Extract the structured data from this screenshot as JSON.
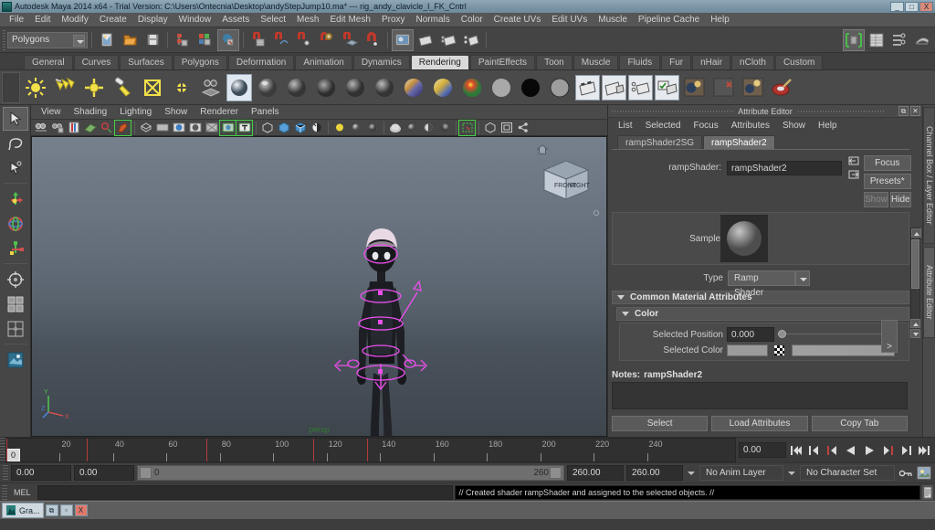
{
  "window": {
    "title": "Autodesk Maya 2014 x64 - Trial Version: C:\\Users\\Ontecnia\\Desktop\\andyStepJump10.ma*   ---   rig_andy_clavicle_l_FK_Cntrl",
    "minimize": "_",
    "maximize": "□",
    "close": "X"
  },
  "menubar": {
    "items": [
      "File",
      "Edit",
      "Modify",
      "Create",
      "Display",
      "Window",
      "Assets",
      "Select",
      "Mesh",
      "Edit Mesh",
      "Proxy",
      "Normals",
      "Color",
      "Create UVs",
      "Edit UVs",
      "Muscle",
      "Pipeline Cache",
      "Help"
    ]
  },
  "statusline": {
    "mode_selector": "Polygons",
    "icons": [
      "new-scene-icon",
      "open-scene-icon",
      "save-scene-icon",
      "select-hierarchy-icon",
      "select-object-icon",
      "select-component-icon",
      "snap-grid-icon",
      "snap-curve-icon",
      "snap-point-icon",
      "snap-projected-center-icon",
      "snap-view-plane-icon",
      "snap-magnet-icon",
      "render-view-icon",
      "render-current-frame-icon",
      "ipr-render-icon",
      "render-settings-icon"
    ],
    "right_icons": [
      "toggle-sidebar-icon",
      "channel-box-icon",
      "attribute-editor-icon",
      "tool-settings-icon"
    ]
  },
  "shelf": {
    "tabs": [
      "General",
      "Curves",
      "Surfaces",
      "Polygons",
      "Deformation",
      "Animation",
      "Dynamics",
      "Rendering",
      "PaintEffects",
      "Toon",
      "Muscle",
      "Fluids",
      "Fur",
      "nHair",
      "nCloth",
      "Custom"
    ],
    "active_tab": "Rendering",
    "icons": [
      "ambient-light-icon",
      "directional-light-icon",
      "point-light-icon",
      "spot-light-icon",
      "area-light-icon",
      "volume-light-icon",
      "light-linking-icon",
      "lambert-material-icon",
      "blinn-material-icon",
      "phong-material-icon",
      "phonge-material-icon",
      "anisotropic-material-icon",
      "layered-shader-icon",
      "ramp-shader-icon",
      "ramp-texture-icon",
      "surface-shader-icon",
      "use-background-icon",
      "shading-map-icon",
      "render-current-frame-icon",
      "ipr-render-icon",
      "batch-render-icon",
      "render-settings-icon",
      "hypershade-icon",
      "render-layer-icon",
      "render-globals-icon",
      "paint-textures-icon"
    ]
  },
  "toolbox": {
    "items": [
      "select-tool",
      "lasso-select-tool",
      "paint-select-tool",
      "move-tool",
      "rotate-tool",
      "scale-tool",
      "universal-manipulator",
      "soft-modification-tool",
      "show-manipulator-tool",
      "last-tool-used",
      "single-perspective-layout",
      "four-view-layout",
      "persp-outliner-layout"
    ]
  },
  "viewport": {
    "menus": [
      "View",
      "Shading",
      "Lighting",
      "Show",
      "Renderer",
      "Panels"
    ],
    "toolbar_icons": [
      "select-camera-icon",
      "lock-camera-icon",
      "bookmarks-icon",
      "image-plane-icon",
      "two-dimensional-pan-zoom-icon",
      "grease-pencil-icon",
      "wireframe-icon",
      "smooth-shade-icon",
      "shaded-textured-icon",
      "use-all-lights-icon",
      "shadows-icon",
      "screen-space-ao-icon",
      "motion-blur-icon",
      "isolate-select-icon",
      "xray-icon",
      "xray-joints-icon",
      "xray-active-components-icon",
      "exposure-icon",
      "gamma-icon",
      "view-transform-icon",
      "color-management-icon",
      "ipr-region-icon",
      "single-pane-icon",
      "multi-pane-icon",
      "grease-pencil-share-icon"
    ],
    "camera_label": "persp",
    "viewcube_front": "FRONT",
    "viewcube_right": "RIGHT",
    "axis_y": "Y",
    "axis_x": "X",
    "axis_z": "Z"
  },
  "attribute_editor": {
    "panel_title": "Attribute Editor",
    "dock_button": "⧉",
    "close_button": "✕",
    "menus": [
      "List",
      "Selected",
      "Focus",
      "Attributes",
      "Show",
      "Help"
    ],
    "tabs": [
      "rampShader2SG",
      "rampShader2"
    ],
    "active_tab": "rampShader2",
    "node_label": "rampShader:",
    "node_name": "rampShader2",
    "focus_button": "Focus",
    "presets_button": "Presets*",
    "show_button": "Show",
    "hide_button": "Hide",
    "sample_label": "Sample",
    "type_label": "Type",
    "type_value": "Ramp Shader",
    "section_common": "Common Material Attributes",
    "section_color": "Color",
    "selected_position_label": "Selected Position",
    "selected_position_value": "0.000",
    "selected_color_label": "Selected Color",
    "ramp_expand_button": ">",
    "notes_label": "Notes:",
    "notes_node": "rampShader2",
    "notes_value": "",
    "buttons": [
      "Select",
      "Load Attributes",
      "Copy Tab"
    ]
  },
  "right_strip": {
    "tabs": [
      "Channel Box / Layer Editor",
      "Attribute Editor"
    ]
  },
  "timeline": {
    "labels": [
      "20",
      "40",
      "60",
      "80",
      "100",
      "120",
      "140",
      "160",
      "180",
      "200",
      "220",
      "240"
    ],
    "label_positions": [
      20,
      40,
      60,
      80,
      100,
      120,
      140,
      160,
      180,
      200,
      220,
      240
    ],
    "range_start": 0,
    "range_end": 260,
    "current_frame": "0",
    "keyframes": [
      30,
      75,
      115,
      135
    ],
    "current_time_field": "0.00",
    "playback_buttons": [
      "go-to-start-icon",
      "step-back-keyframe-icon",
      "step-back-frame-icon",
      "play-backwards-icon",
      "play-forwards-icon",
      "step-forward-frame-icon",
      "step-forward-keyframe-icon",
      "go-to-end-icon"
    ]
  },
  "range_slider": {
    "anim_start": "0.00",
    "range_start": "0.00",
    "slider_min_label": "0",
    "slider_max_label": "260",
    "range_end": "260.00",
    "anim_end": "260.00",
    "anim_layer": "No Anim Layer",
    "character_set": "No Character Set",
    "auto_key_icon": "auto-keyframe-icon",
    "anim_prefs_icon": "animation-preferences-icon"
  },
  "command_line": {
    "language_label": "MEL",
    "input_value": "",
    "output_message": "// Created shader rampShader and assigned to the selected objects. //",
    "script_editor_icon": "script-editor-icon"
  },
  "taskbar": {
    "item_label": "Gra...",
    "restore_label": "⧉",
    "minimize_label": "▫",
    "close_label": "X"
  },
  "colors": {
    "accent_green": "#45d045",
    "keyframe_red": "#b23c3c",
    "camera_label_green": "#2f7a2f",
    "titlebar": "#7d97a8",
    "panel_bg": "#444444",
    "viewport_top": "#76808c",
    "viewport_bottom": "#3e454d",
    "character_highlight": "#ee4fee"
  }
}
